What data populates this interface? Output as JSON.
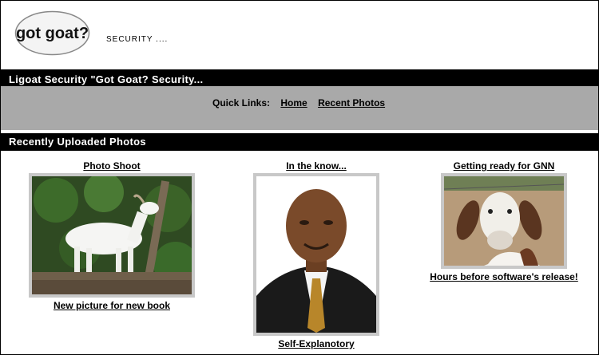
{
  "header": {
    "logo_text": "got goat?",
    "tagline": "SECURITY ...."
  },
  "title_bar": {
    "text": "Ligoat Security \"Got Goat? Security..."
  },
  "quick_links": {
    "label": "Quick Links:",
    "links": [
      "Home",
      "Recent Photos"
    ]
  },
  "section": {
    "title": "Recently Uploaded Photos"
  },
  "photos": [
    {
      "title": "Photo Shoot",
      "caption": "New picture for new book"
    },
    {
      "title": "In the know...",
      "caption": "Self-Explanotory"
    },
    {
      "title": "Getting ready for GNN",
      "caption": "Hours before software's release!"
    }
  ],
  "colors": {
    "bar": "#000000",
    "quick_links_bg": "#a9a9a9",
    "thumb_border": "#c8c8c8"
  }
}
